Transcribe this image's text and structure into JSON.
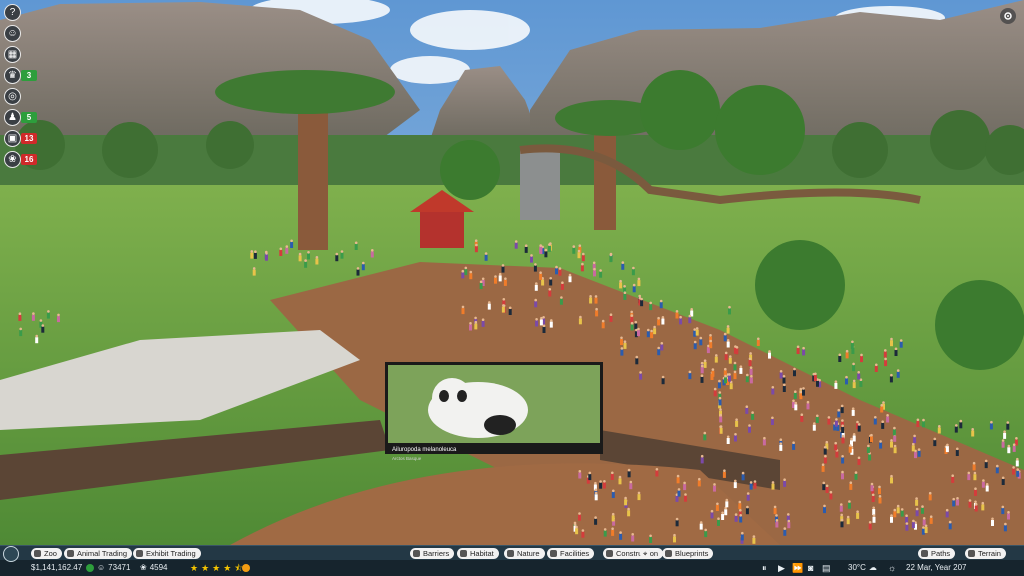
{
  "hud": {
    "left_toolbar": [
      {
        "icon": "help-icon",
        "glyph": "?",
        "badge": ""
      },
      {
        "icon": "guest-face-icon",
        "glyph": "☺",
        "badge": ""
      },
      {
        "icon": "calendar-icon",
        "glyph": "▦",
        "badge": ""
      },
      {
        "icon": "trophy-icon",
        "glyph": "♛",
        "badge": "3",
        "badge_color": "green"
      },
      {
        "icon": "research-icon",
        "glyph": "◎",
        "badge": ""
      },
      {
        "icon": "staff-icon",
        "glyph": "♟",
        "badge": "5",
        "badge_color": "green"
      },
      {
        "icon": "habitat-alert-icon",
        "glyph": "▣",
        "badge": "13",
        "badge_color": "red"
      },
      {
        "icon": "animal-alert-icon",
        "glyph": "❀",
        "badge": "16",
        "badge_color": "red"
      }
    ]
  },
  "screen": {
    "exhibit_title": "Ailuropoda melanoleuca",
    "exhibit_subtitle": "Arctos Basque"
  },
  "toolbar": {
    "left": [
      {
        "label": "Zoo",
        "icon": "zoo-icon"
      },
      {
        "label": "Animal Trading",
        "icon": "animal-trading-icon"
      },
      {
        "label": "Exhibit Trading",
        "icon": "exhibit-trading-icon"
      }
    ],
    "center": [
      {
        "label": "Barriers",
        "icon": "barriers-icon"
      },
      {
        "label": "Habitat",
        "icon": "habitat-icon"
      },
      {
        "label": "Nature",
        "icon": "nature-icon"
      },
      {
        "label": "Facilities",
        "icon": "facilities-icon"
      },
      {
        "label": "Construction",
        "icon": "construction-icon"
      },
      {
        "label": "Blueprints",
        "icon": "blueprints-icon"
      }
    ],
    "right": [
      {
        "label": "Paths",
        "icon": "paths-icon"
      },
      {
        "label": "Terrain",
        "icon": "terrain-icon"
      }
    ]
  },
  "status": {
    "money": "$1,141,162.47",
    "guests": "73471",
    "animals": "4594",
    "rating": 4.5,
    "rating_max": 5,
    "temperature": "30°C",
    "date": "22 Mar, Year 207"
  },
  "colors": {
    "accent": "#f2f2f2",
    "bar": "#1f3340",
    "money_green": "#2d9e3c",
    "alert_red": "#cf2a2a",
    "star": "#f5c400",
    "mood": "#f39c12"
  }
}
